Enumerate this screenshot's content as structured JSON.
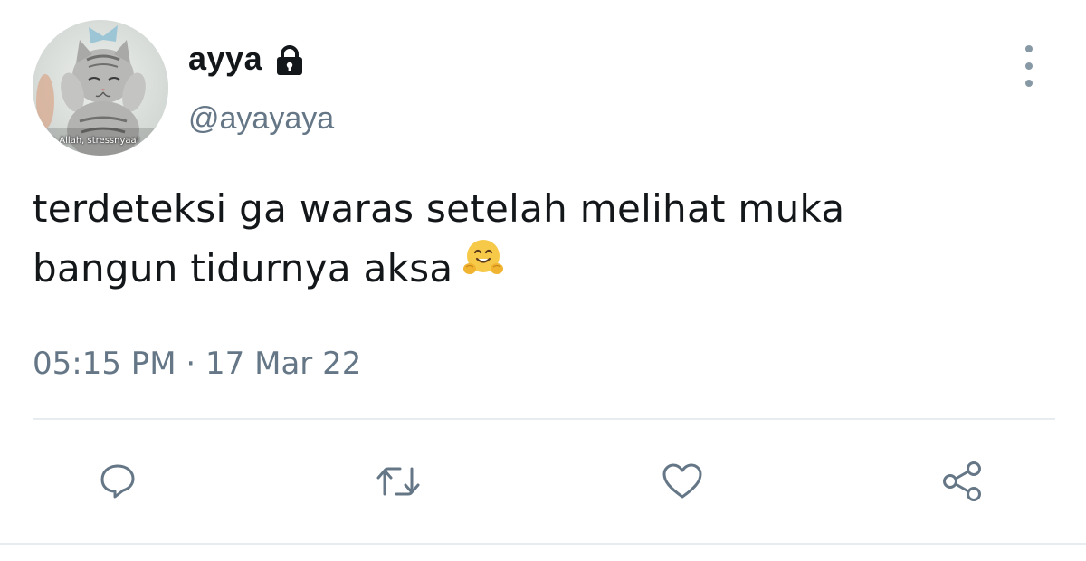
{
  "user": {
    "display_name": "ayya",
    "handle": "@ayayaya",
    "avatar_caption": "a Allah, stressnyaa!",
    "protected_icon": "lock-icon"
  },
  "tweet": {
    "text_line1": "terdeteksi ga waras setelah melihat muka",
    "text_line2": "bangun tidurnya aksa",
    "emoji": "hugging-face-emoji",
    "timestamp": "05:15 PM · 17 Mar 22"
  },
  "actions": [
    {
      "name": "reply",
      "icon": "speech-bubble-icon"
    },
    {
      "name": "retweet",
      "icon": "retweet-icon"
    },
    {
      "name": "like",
      "icon": "heart-icon"
    },
    {
      "name": "share",
      "icon": "share-icon"
    }
  ],
  "colors": {
    "text": "#14171a",
    "secondary": "#657786",
    "icon": "#657786",
    "divider": "#e6ecf0"
  }
}
